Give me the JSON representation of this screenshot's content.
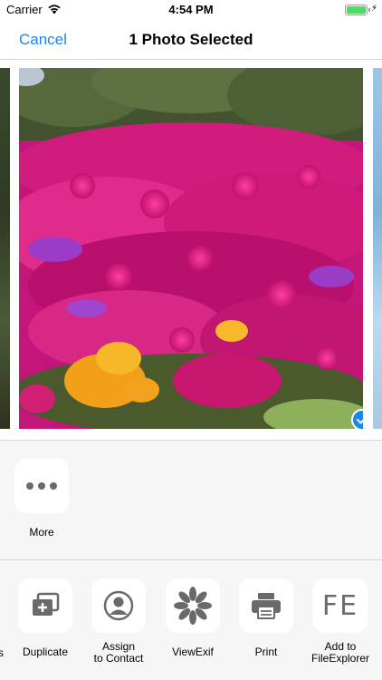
{
  "status_bar": {
    "carrier": "Carrier",
    "time": "4:54 PM",
    "battery_level": 1.0,
    "charging": true
  },
  "nav": {
    "cancel_label": "Cancel",
    "title": "1 Photo Selected"
  },
  "photos": {
    "selected_count": 1
  },
  "more_action": {
    "label": "More",
    "icon": "more-dots-icon"
  },
  "actions": [
    {
      "label": "Duplicate",
      "icon": "duplicate-icon"
    },
    {
      "line1": "Assign",
      "line2": "to Contact",
      "icon": "contact-icon"
    },
    {
      "label": "ViewExif",
      "icon": "aperture-icon"
    },
    {
      "label": "Print",
      "icon": "printer-icon"
    },
    {
      "line1": "Add to",
      "line2": "FileExplorer",
      "icon": "fe-logo-icon",
      "icon_text": "FE"
    }
  ],
  "colors": {
    "accent": "#1f83ec",
    "icon_gray": "#6a6a6e",
    "background": "#f6f6f7"
  }
}
